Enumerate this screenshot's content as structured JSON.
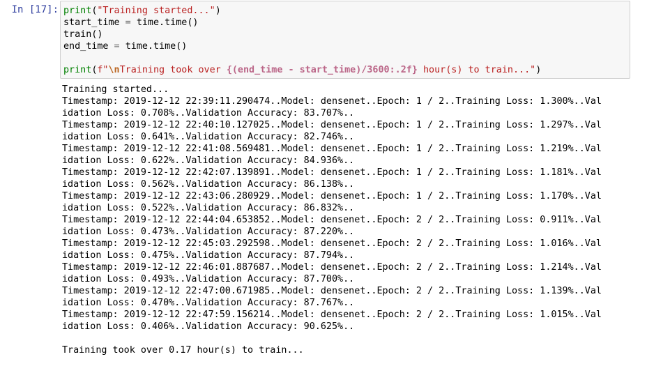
{
  "cell": {
    "prompt": "In [17]:",
    "code": {
      "line1": {
        "fn": "print",
        "open": "(",
        "str": "\"Training started...\"",
        "close": ")"
      },
      "line2": {
        "lhs": "start_time",
        "op": " = ",
        "rhs": "time.time()"
      },
      "line3": {
        "text": "train()"
      },
      "line4": {
        "lhs": "end_time",
        "op": " = ",
        "rhs": "time.time()"
      },
      "line6": {
        "fn": "print",
        "open": "(",
        "fprefix": "f\"",
        "esc": "\\n",
        "text1": "Training took over ",
        "interp": "{(end_time - start_time)/3600:.2f}",
        "text2": " hour(s) to train...\"",
        "close": ")"
      }
    },
    "output_lines": [
      "Training started...",
      "Timestamp: 2019-12-12 22:39:11.290474..Model: densenet..Epoch: 1 / 2..Training Loss: 1.300%..Val",
      "idation Loss: 0.708%..Validation Accuracy: 83.707%..",
      "Timestamp: 2019-12-12 22:40:10.127025..Model: densenet..Epoch: 1 / 2..Training Loss: 1.297%..Val",
      "idation Loss: 0.641%..Validation Accuracy: 82.746%..",
      "Timestamp: 2019-12-12 22:41:08.569481..Model: densenet..Epoch: 1 / 2..Training Loss: 1.219%..Val",
      "idation Loss: 0.622%..Validation Accuracy: 84.936%..",
      "Timestamp: 2019-12-12 22:42:07.139891..Model: densenet..Epoch: 1 / 2..Training Loss: 1.181%..Val",
      "idation Loss: 0.562%..Validation Accuracy: 86.138%..",
      "Timestamp: 2019-12-12 22:43:06.280929..Model: densenet..Epoch: 1 / 2..Training Loss: 1.170%..Val",
      "idation Loss: 0.522%..Validation Accuracy: 86.832%..",
      "Timestamp: 2019-12-12 22:44:04.653852..Model: densenet..Epoch: 2 / 2..Training Loss: 0.911%..Val",
      "idation Loss: 0.473%..Validation Accuracy: 87.220%..",
      "Timestamp: 2019-12-12 22:45:03.292598..Model: densenet..Epoch: 2 / 2..Training Loss: 1.016%..Val",
      "idation Loss: 0.475%..Validation Accuracy: 87.794%..",
      "Timestamp: 2019-12-12 22:46:01.887687..Model: densenet..Epoch: 2 / 2..Training Loss: 1.214%..Val",
      "idation Loss: 0.493%..Validation Accuracy: 87.700%..",
      "Timestamp: 2019-12-12 22:47:00.671985..Model: densenet..Epoch: 2 / 2..Training Loss: 1.139%..Val",
      "idation Loss: 0.470%..Validation Accuracy: 87.767%..",
      "Timestamp: 2019-12-12 22:47:59.156214..Model: densenet..Epoch: 2 / 2..Training Loss: 1.015%..Val",
      "idation Loss: 0.406%..Validation Accuracy: 90.625%..",
      "",
      "Training took over 0.17 hour(s) to train..."
    ]
  },
  "colors": {
    "prompt": "#303f9f",
    "input_bg": "#f7f7f7",
    "input_border": "#cfcfcf",
    "builtin": "#008000",
    "string": "#ba2121",
    "escape": "#bb6622",
    "interpolation": "#bb6688"
  }
}
